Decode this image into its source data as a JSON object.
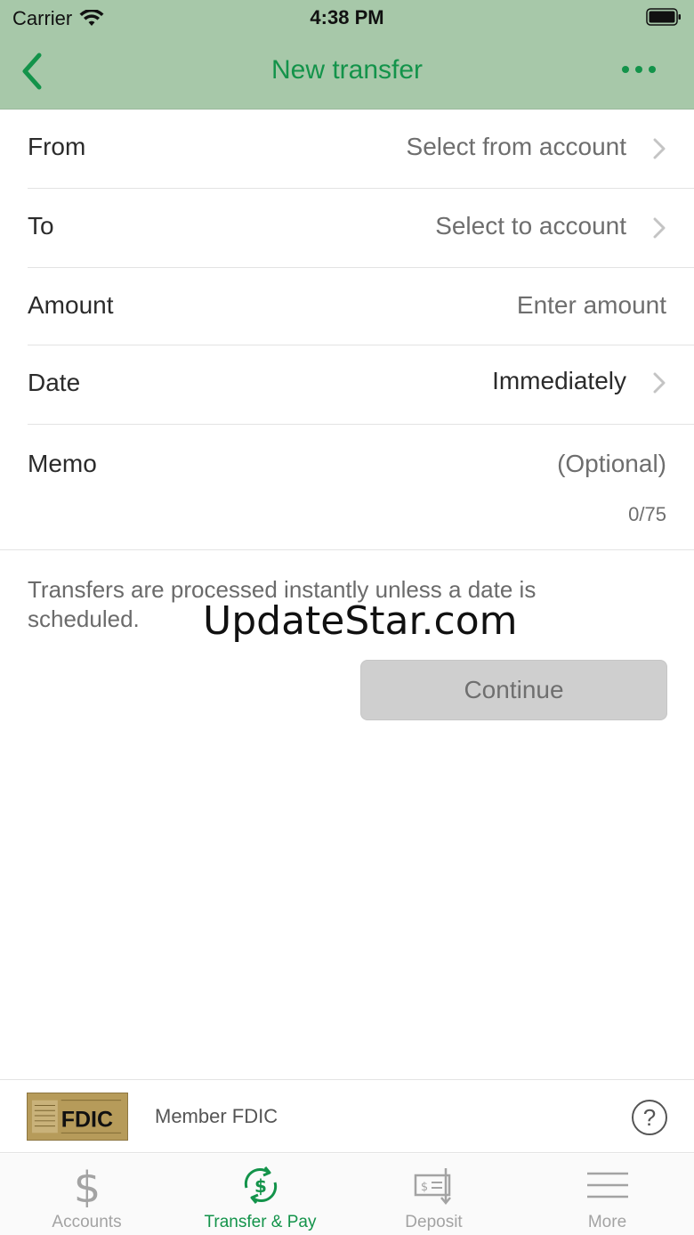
{
  "status_bar": {
    "carrier": "Carrier",
    "time": "4:38 PM"
  },
  "header": {
    "title": "New transfer",
    "back_icon": "chevron-left-icon",
    "menu_icon": "more-dots-icon",
    "accent": "#13934a",
    "background": "#a7c8a9"
  },
  "form": {
    "from": {
      "label": "From",
      "value": "Select from account"
    },
    "to": {
      "label": "To",
      "value": "Select to account"
    },
    "amount": {
      "label": "Amount",
      "placeholder": "Enter amount"
    },
    "date": {
      "label": "Date",
      "value": "Immediately"
    },
    "memo": {
      "label": "Memo",
      "placeholder": "(Optional)",
      "counter": "0/75"
    }
  },
  "note": "Transfers are processed instantly unless a date is scheduled.",
  "watermark": "UpdateStar.com",
  "continue_label": "Continue",
  "fdic": {
    "logo_text": "FDIC",
    "text": "Member FDIC",
    "help_symbol": "?"
  },
  "tabs": [
    {
      "label": "Accounts",
      "icon": "dollar-icon",
      "active": false
    },
    {
      "label": "Transfer & Pay",
      "icon": "transfer-dollar-icon",
      "active": true
    },
    {
      "label": "Deposit",
      "icon": "check-deposit-icon",
      "active": false
    },
    {
      "label": "More",
      "icon": "hamburger-icon",
      "active": false
    }
  ]
}
